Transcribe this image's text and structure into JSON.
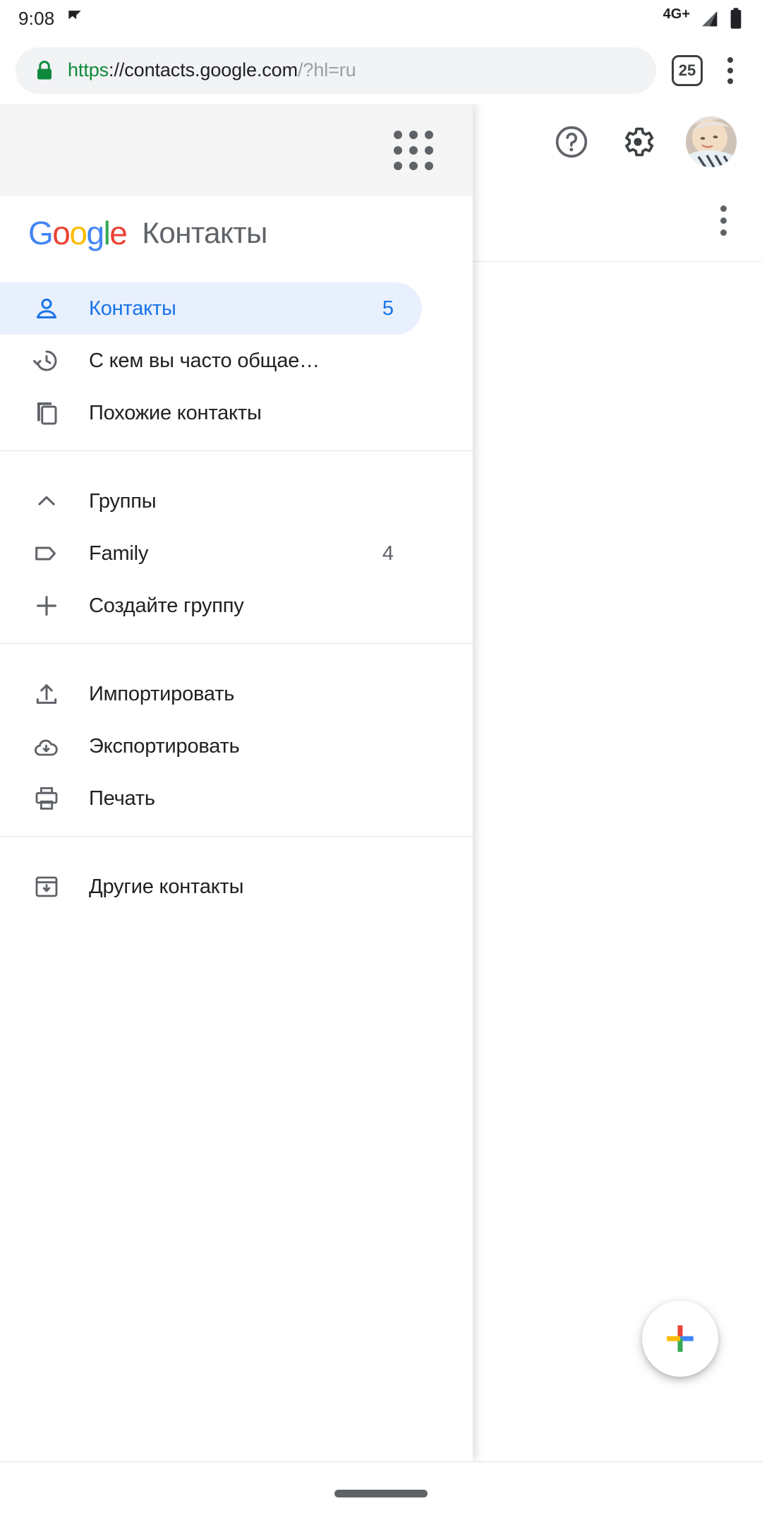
{
  "status_bar": {
    "clock": "9:08",
    "notification_icon": "app-notification-icon",
    "network_label": "4G+",
    "signal_icon": "signal-icon",
    "battery_icon": "battery-icon"
  },
  "browser": {
    "lock_icon": "lock-icon",
    "url_scheme": "https",
    "url_host": "://contacts.google.com",
    "url_query": "/?hl=ru",
    "url_full": "https://contacts.google.com/?hl=ru",
    "tab_count": "25",
    "menu_icon": "kebab-menu-icon"
  },
  "content": {
    "help_icon": "help-icon",
    "settings_icon": "gear-icon",
    "avatar_icon": "avatar",
    "more_options_icon": "kebab-menu-icon"
  },
  "drawer": {
    "apps_icon": "apps-grid-icon",
    "logo": {
      "letters": [
        "G",
        "o",
        "o",
        "g",
        "l",
        "e"
      ],
      "app_name": "Контакты"
    },
    "sections": [
      {
        "items": [
          {
            "icon": "person-icon",
            "label": "Контакты",
            "count": "5",
            "active": true
          },
          {
            "icon": "history-icon",
            "label": "С кем вы часто общае…",
            "count": "",
            "active": false
          },
          {
            "icon": "duplicate-icon",
            "label": "Похожие контакты",
            "count": "",
            "active": false
          }
        ]
      },
      {
        "items": [
          {
            "icon": "chevron-up-icon",
            "label": "Группы",
            "count": "",
            "active": false
          },
          {
            "icon": "tag-icon",
            "label": "Family",
            "count": "4",
            "active": false
          },
          {
            "icon": "plus-icon",
            "label": "Создайте группу",
            "count": "",
            "active": false
          }
        ]
      },
      {
        "items": [
          {
            "icon": "upload-icon",
            "label": "Импортировать",
            "count": "",
            "active": false
          },
          {
            "icon": "cloud-download-icon",
            "label": "Экспортировать",
            "count": "",
            "active": false
          },
          {
            "icon": "printer-icon",
            "label": "Печать",
            "count": "",
            "active": false
          }
        ]
      },
      {
        "items": [
          {
            "icon": "archive-down-icon",
            "label": "Другие контакты",
            "count": "",
            "active": false
          }
        ]
      }
    ]
  },
  "fab": {
    "icon": "plus-icon",
    "colors": {
      "top": "#ea4335",
      "right": "#4285f4",
      "bottom": "#34a853",
      "left": "#fbbc04"
    }
  },
  "system_nav": {
    "home_pill": "home-indicator"
  },
  "colors": {
    "accent": "#1a73e8",
    "active_bg": "#e8f0fe",
    "icon_gray": "#5f6368",
    "text": "#202124",
    "secure_green": "#0f8a3c"
  }
}
